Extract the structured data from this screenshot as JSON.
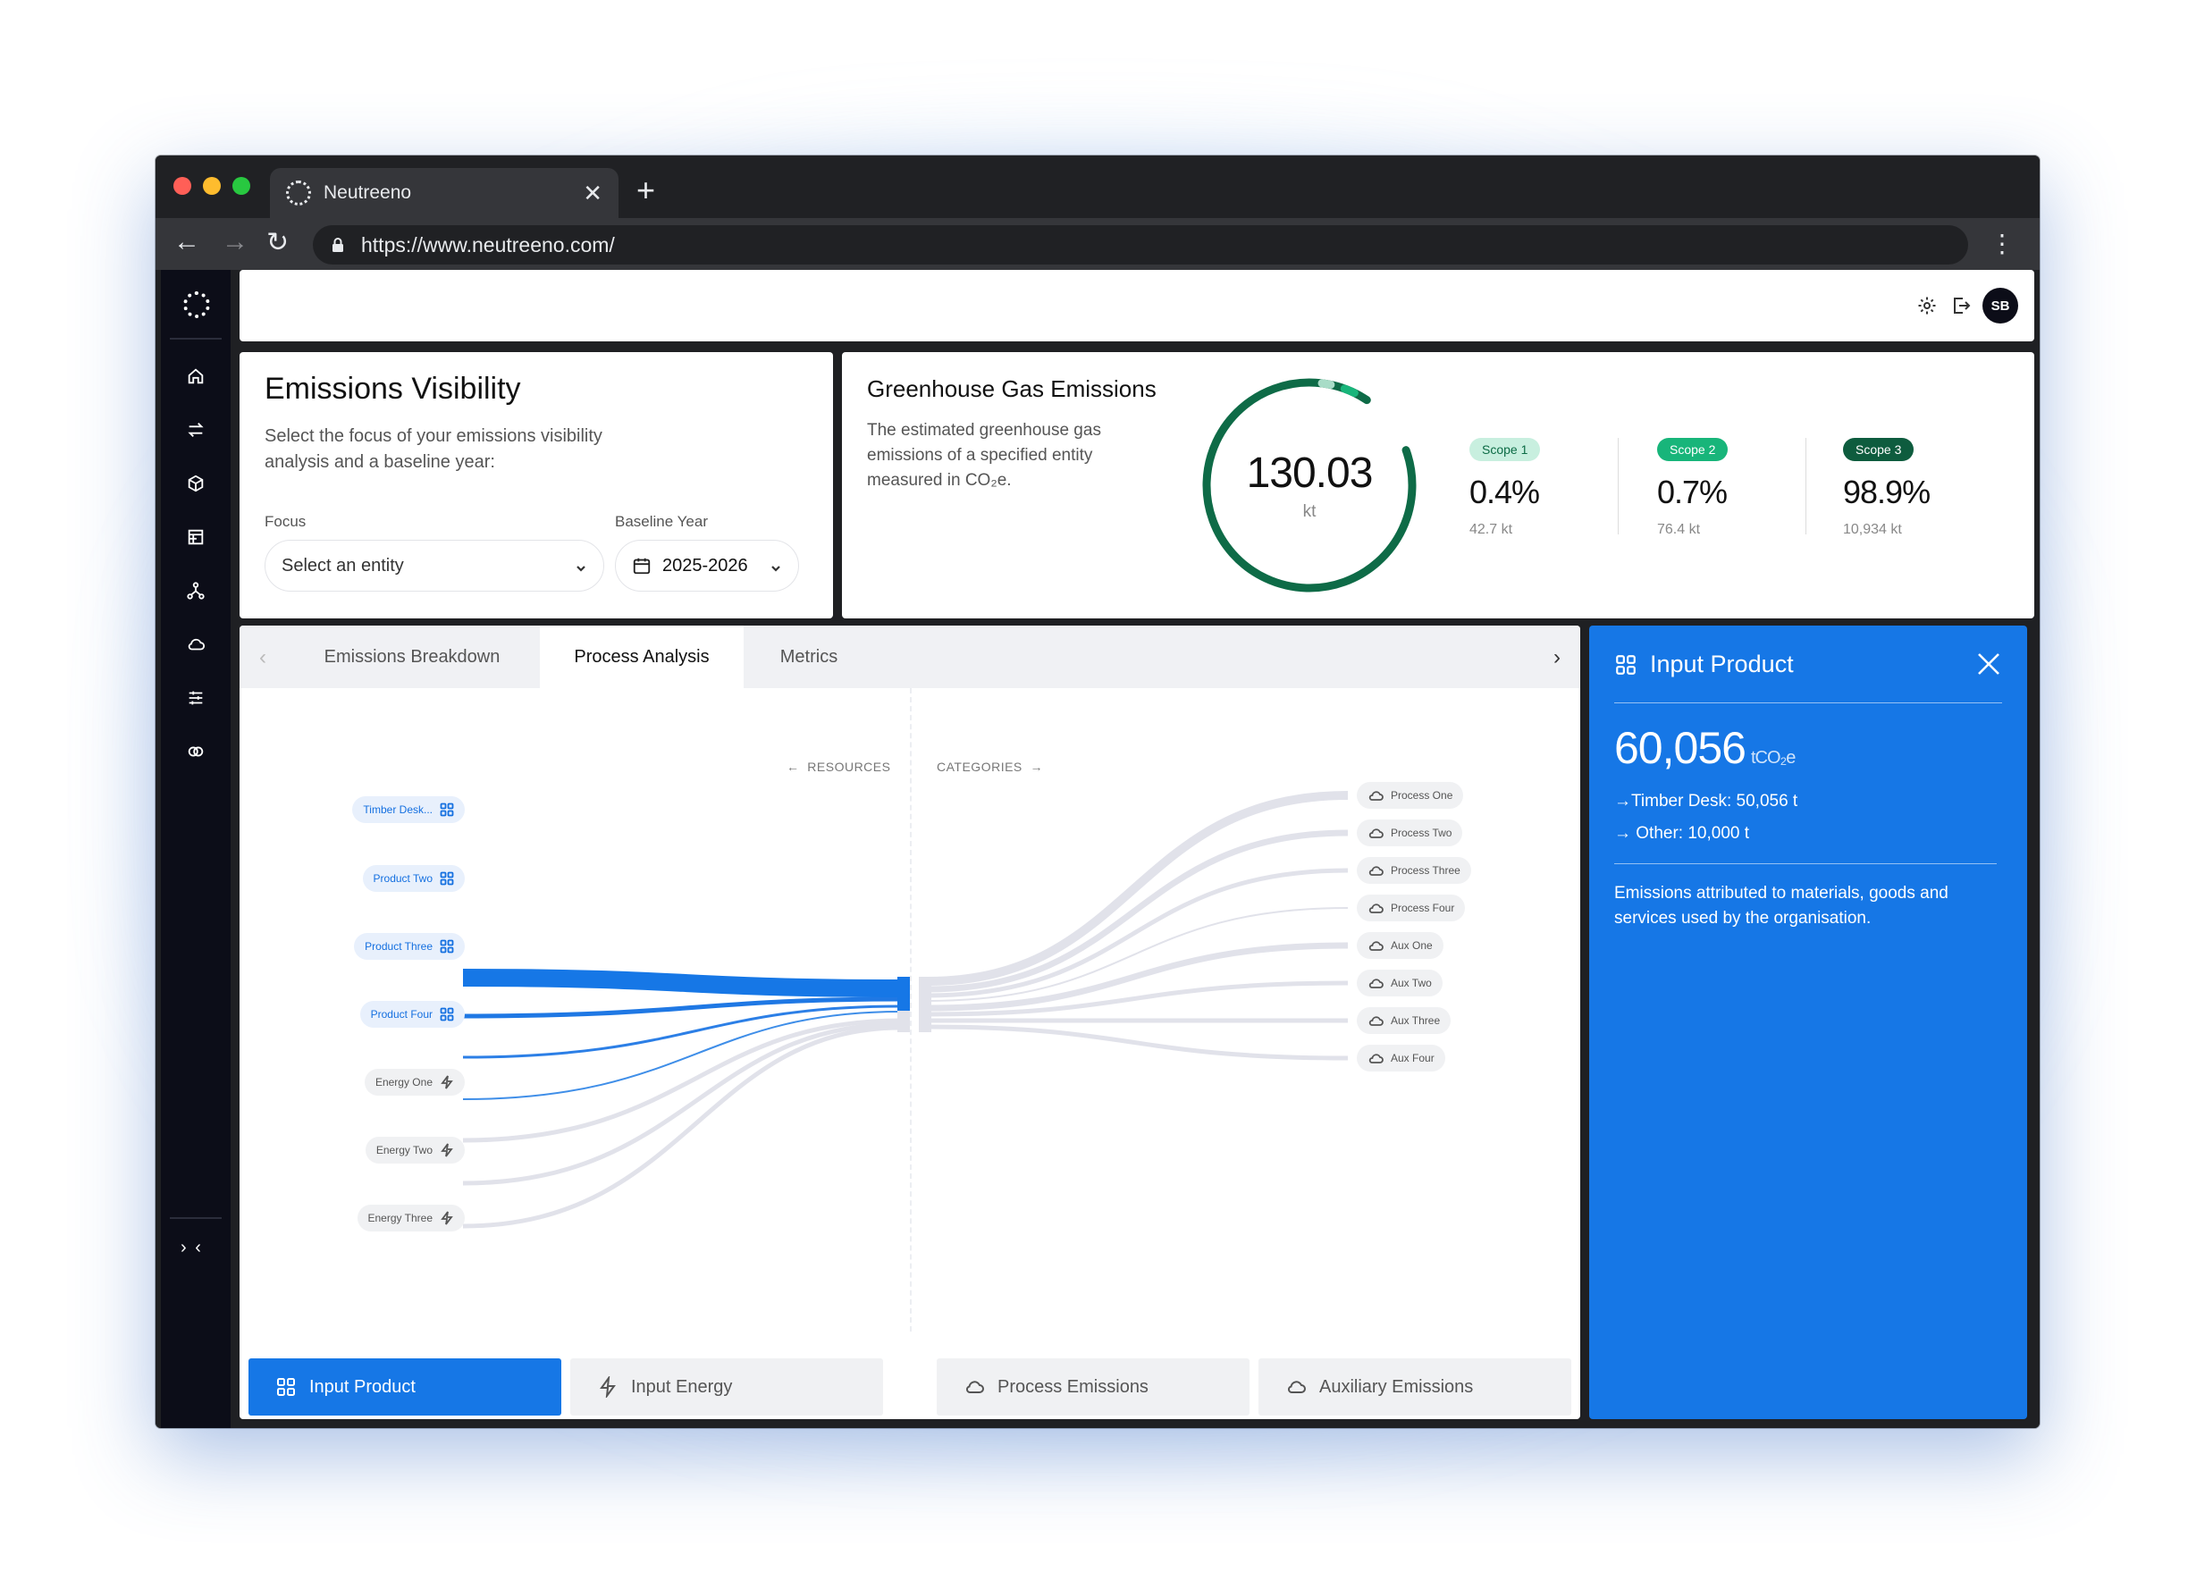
{
  "browser": {
    "tab_title": "Neutreeno",
    "url": "https://www.neutreeno.com/"
  },
  "user": {
    "initials": "SB"
  },
  "visibility": {
    "title": "Emissions Visibility",
    "description": "Select the focus of your emissions visibility analysis and a baseline year:",
    "focus_label": "Focus",
    "focus_placeholder": "Select an entity",
    "baseline_label": "Baseline Year",
    "baseline_value": "2025-2026"
  },
  "ghg": {
    "title": "Greenhouse Gas Emissions",
    "description": "The estimated greenhouse gas emissions of a specified entity measured in CO₂e.",
    "total": "130.03",
    "unit": "kt",
    "scopes": [
      {
        "label": "Scope 1",
        "pct": "0.4%",
        "kt": "42.7 kt",
        "badge_bg": "#c8efdf",
        "badge_fg": "#0c6b45"
      },
      {
        "label": "Scope 2",
        "pct": "0.7%",
        "kt": "76.4 kt",
        "badge_bg": "#18b57a",
        "badge_fg": "#ffffff"
      },
      {
        "label": "Scope 3",
        "pct": "98.9%",
        "kt": "10,934 kt",
        "badge_bg": "#0e5c3e",
        "badge_fg": "#ffffff"
      }
    ]
  },
  "analysis": {
    "tabs": [
      "Emissions Breakdown",
      "Process Analysis",
      "Metrics"
    ],
    "active_tab": "Process Analysis",
    "resources_label": "RESOURCES",
    "categories_label": "CATEGORIES",
    "resources": [
      {
        "label": "Timber Desk...",
        "icon": "grid-icon",
        "active": true
      },
      {
        "label": "Product Two",
        "icon": "grid-icon",
        "active": true
      },
      {
        "label": "Product Three",
        "icon": "grid-icon",
        "active": true
      },
      {
        "label": "Product Four",
        "icon": "grid-icon",
        "active": true
      },
      {
        "label": "Energy One",
        "icon": "bolt-icon",
        "active": false
      },
      {
        "label": "Energy Two",
        "icon": "bolt-icon",
        "active": false
      },
      {
        "label": "Energy Three",
        "icon": "bolt-icon",
        "active": false
      }
    ],
    "categories": [
      "Process One",
      "Process Two",
      "Process Three",
      "Process Four",
      "Aux One",
      "Aux Two",
      "Aux Three",
      "Aux Four"
    ],
    "bottom_buttons": [
      {
        "label": "Input Product",
        "icon": "grid-icon",
        "active": true
      },
      {
        "label": "Input Energy",
        "icon": "bolt-icon",
        "active": false
      },
      {
        "label": "Process Emissions",
        "icon": "cloud-icon",
        "active": false
      },
      {
        "label": "Auxiliary Emissions",
        "icon": "cloud-icon",
        "active": false
      }
    ]
  },
  "detail": {
    "title": "Input Product",
    "value": "60,056",
    "unit": "tCO₂e",
    "lines": [
      "→Timber Desk: 50,056 t",
      "→ Other: 10,000 t"
    ],
    "description": "Emissions attributed to materials, goods and services used by the organisation."
  },
  "colors": {
    "accent": "#1677e6",
    "gauge": "#0e6b47",
    "gauge_light": "#a8dcc7",
    "flow_grey": "#dcdde6"
  }
}
